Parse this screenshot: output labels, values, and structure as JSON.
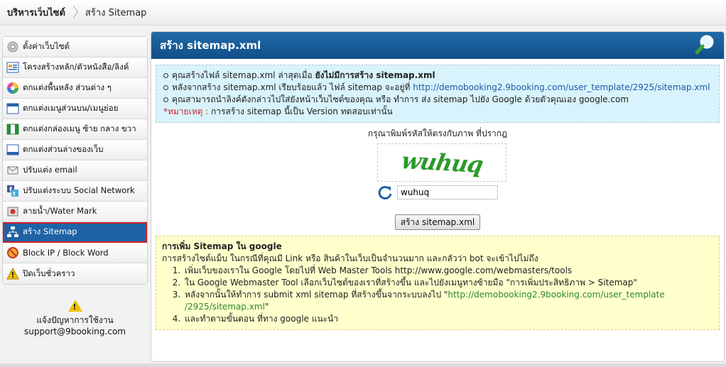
{
  "breadcrumb": {
    "root": "บริหารเว็บไซต์",
    "current": "สร้าง Sitemap"
  },
  "sidebar": {
    "items": [
      {
        "label": "ตั้งค่าเว็บไซต์",
        "icon": "settings-icon"
      },
      {
        "label": "โครงสร้างหลัก/ตัวหนังสือ/ลิงค์",
        "icon": "structure-icon"
      },
      {
        "label": "ตกแต่งพื้นหลัง ส่วนต่าง ๆ",
        "icon": "color-wheel-icon"
      },
      {
        "label": "ตกแต่งเมนูส่วนบน/เมนูย่อย",
        "icon": "top-menu-icon"
      },
      {
        "label": "ตกแต่งกล่องเมนู ซ้าย กลาง ขวา",
        "icon": "menu-box-icon"
      },
      {
        "label": "ตกแต่งส่วนล่างของเว็บ",
        "icon": "footer-icon"
      },
      {
        "label": "ปรับแต่ง email",
        "icon": "email-icon"
      },
      {
        "label": "ปรับแต่งระบบ Social Network",
        "icon": "social-network-icon"
      },
      {
        "label": "ลายน้ำ/Water Mark",
        "icon": "watermark-icon"
      },
      {
        "label": "สร้าง Sitemap",
        "icon": "sitemap-icon",
        "active": true
      },
      {
        "label": "Block IP / Block Word",
        "icon": "block-icon"
      },
      {
        "label": "ปิดเว็บชั่วคราว",
        "icon": "warning-sign-icon"
      }
    ]
  },
  "support": {
    "line1": "แจ้งปัญหาการใช้งาน",
    "line2": "support@9booking.com"
  },
  "main": {
    "title": "สร้าง sitemap.xml",
    "info": {
      "line1_prefix": "คุณสร้างไฟล์ sitemap.xml ล่าสุดเมื่อ",
      "line1_bold": "ยังไม่มีการสร้าง sitemap.xml",
      "line2_prefix": "หลังจากสร้าง sitemap.xml เรียบร้อยแล้ว ไฟล์ sitemap จะอยู่ที่",
      "line2_link": "http://demobooking2.9booking.com/user_template/2925/sitemap.xml",
      "line3": "คุณสามารถนำลิงค์ดังกล่าวไปใส่ยังหน้าเว็บไซต์ของคุณ หรือ ทำการ ส่ง sitemap ไปยัง Google ด้วยตัวคุณเอง google.com",
      "note_label": "*หมายเหตุ :",
      "note_text": "การสร้าง sitemap นี้เป็น Version ทดสอบเท่านั้น"
    },
    "captcha": {
      "prompt": "กรุณาพิมพ์รหัสให้ตรงกับภาพ ที่ปรากฎ",
      "image_text": "wuhuq",
      "input_value": "wuhuq"
    },
    "submit_label": "สร้าง sitemap.xml",
    "help": {
      "title": "การเพิ่ม Sitemap ใน google",
      "intro": "การสร้างไซต์แม็บ ในกรณีที่คุณมี Link หรือ สินค้าในเว็บเป็นจำนวนมาก และกลัวว่า bot จะเข้าไปไม่ถึง",
      "step1": "เพิ่มเว็บของเราใน Google โดยไปที่ Web Master Tools http://www.google.com/webmasters/tools",
      "step2": "ใน Google Webmaster Tool เลือกเว็บไซต์ของเราที่สร้างขึ้น และไปยังเมนูทางซ้ายมือ \"การเพิ่มประสิทธิภาพ > Sitemap\"",
      "step3_prefix": "หลังจากนั้นให้ทำการ submit xml sitemap ที่สร้างขึ้นจากระบบลงไป \"",
      "step3_link_a": "http://demobooking2.9booking.com/user_template",
      "step3_link_b": "/2925/sitemap.xml",
      "step3_suffix": "\"",
      "step4": "และทำตามขั้นตอน ที่ทาง google แนะนำ"
    }
  },
  "colors": {
    "header_blue": "#1a5e9c",
    "active_item": "#1e63a6",
    "active_border": "#d0202a",
    "info_bg": "#d8f3fb",
    "help_bg": "#ffffcc",
    "link_blue": "#1c5aa6",
    "link_green": "#2c8a2c"
  }
}
